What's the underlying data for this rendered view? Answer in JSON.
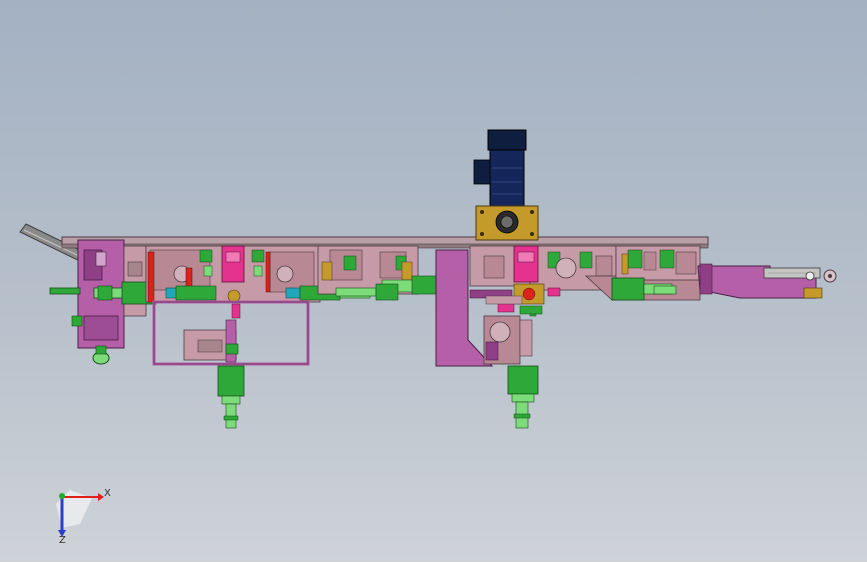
{
  "triad": {
    "x_label": "X",
    "z_label": "Z",
    "y_label": "",
    "x_color": "#e0201b",
    "y_color": "#1fae2b",
    "z_color": "#2a3fc8"
  },
  "colors": {
    "frame": "#b45fa8",
    "frame_dark": "#8e3f86",
    "plate": "#c79aa8",
    "rail": "#a6868c",
    "green": "#2fa83a",
    "green_light": "#7ddc7a",
    "magenta": "#e3338e",
    "motor": "#0f1d3f",
    "bracket": "#c49a2a",
    "red": "#d9241b",
    "cyan": "#21a8b8",
    "cylinder": "#b9b3b8",
    "chute": "#8a8a8a"
  }
}
